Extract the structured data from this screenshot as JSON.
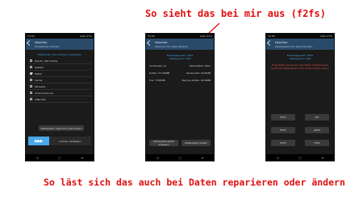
{
  "captions": {
    "top": "So sieht das bei mir aus (f2fs)",
    "bottom": "So läst sich das auch bei Daten reparieren oder ändern"
  },
  "colors": {
    "caption": "#e01010",
    "accent": "#4aa8e8",
    "header": "#2a4a6a"
  },
  "phone1": {
    "status_time": "13:00",
    "status_right": "Akku 57%",
    "title": "Löschen",
    "subtitle": "Erweitertes Löschen",
    "section_label": "Partitionen zum Löschen auswählen",
    "items": [
      {
        "label": "Dalvik / ART Cache",
        "checked": false
      },
      {
        "label": "System",
        "checked": false
      },
      {
        "label": "Daten",
        "checked": true
      },
      {
        "label": "Cache",
        "checked": false
      },
      {
        "label": "SD-Karte",
        "checked": false
      },
      {
        "label": "Android Secure",
        "checked": false
      },
      {
        "label": "USB-OTG",
        "checked": false
      }
    ],
    "repair_button": "Dateisystem reparieren oder ändern",
    "swipe_label": "Löschen bestätigen"
  },
  "phone2": {
    "status_time": "13:00",
    "status_right": "Akku 57%",
    "title": "Löschen",
    "subtitle": "Optionen für diese Partition",
    "mount_label": "Einhängepunkt: /data",
    "fs_label": "Dateisystem: f2fs",
    "present": "Vorhanden: Ja",
    "removable": "Wechselbar: Nein",
    "size": "Größe: 11105MB",
    "used": "Verwendet: 4176MB",
    "free": "Frei: 7700MB",
    "backup_size": "Backup-Größe: 4176MB",
    "resize_button": "Dateisystemgröße anpassen",
    "change_button": "Dateisystem ändern"
  },
  "phone3": {
    "status_time": "13:00",
    "status_right": "Akku 57%",
    "title": "Löschen",
    "subtitle": "Dateisystem für diese Partition",
    "mount_label": "Einhängepunkt: /data",
    "fs_label": "Dateisystem: f2fs",
    "warning": "Einige ROMs oder Kernel unterstützen möglicherweise bestimmte Dateisysteme nicht. Vorsicht walten lassen!",
    "fs_buttons": [
      "EXT2",
      "FAT",
      "EXT3",
      "exFAT",
      "EXT4",
      "F2FS"
    ]
  },
  "nav": {
    "back": "◁",
    "home": "○",
    "menu": "≡"
  }
}
